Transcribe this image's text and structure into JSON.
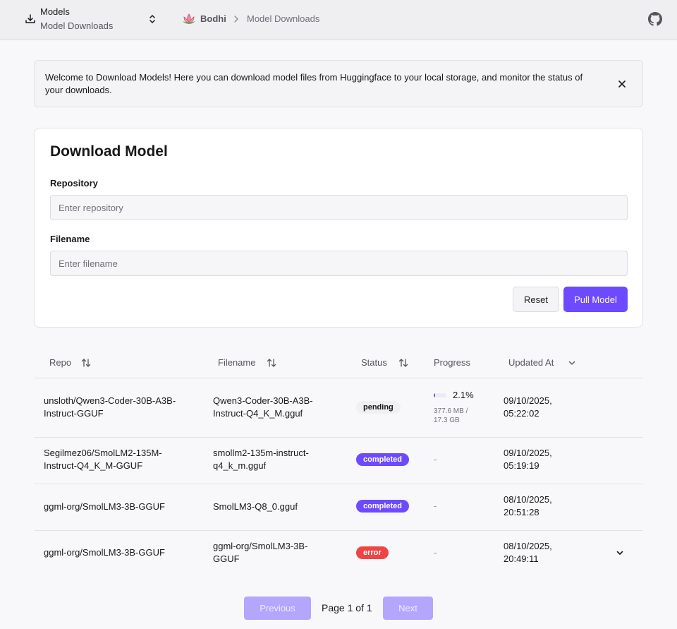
{
  "header": {
    "section_title": "Models",
    "section_subtitle": "Model Downloads",
    "breadcrumb": {
      "home": "Bodhi",
      "current": "Model Downloads"
    }
  },
  "banner": {
    "text": "Welcome to Download Models! Here you can download model files from Huggingface to your local storage, and monitor the status of your downloads."
  },
  "form": {
    "title": "Download Model",
    "repository_label": "Repository",
    "repository_placeholder": "Enter repository",
    "repository_value": "",
    "filename_label": "Filename",
    "filename_placeholder": "Enter filename",
    "filename_value": "",
    "reset_label": "Reset",
    "pull_label": "Pull Model"
  },
  "table": {
    "columns": [
      "Repo",
      "Filename",
      "Status",
      "Progress",
      "Updated At"
    ],
    "rows": [
      {
        "repo_line1": "unsloth/Qwen3-Coder-30B-A3B-",
        "repo_line2": "Instruct-GGUF",
        "file_line1": "Qwen3-Coder-30B-A3B-",
        "file_line2": "Instruct-Q4_K_M.gguf",
        "status": "pending",
        "progress_percent": "2.1%",
        "progress_fraction": 0.021,
        "progress_size_line1": "377.6 MB /",
        "progress_size_line2": "17.3 GB",
        "updated_line1": "09/10/2025,",
        "updated_line2": "05:22:02"
      },
      {
        "repo_line1": "Segilmez06/SmolLM2-135M-",
        "repo_line2": "Instruct-Q4_K_M-GGUF",
        "file_line1": "smollm2-135m-instruct-",
        "file_line2": "q4_k_m.gguf",
        "status": "completed",
        "progress": "-",
        "updated_line1": "09/10/2025,",
        "updated_line2": "05:19:19"
      },
      {
        "repo_line1": "ggml-org/SmolLM3-3B-GGUF",
        "file_line1": "SmolLM3-Q8_0.gguf",
        "status": "completed",
        "progress": "-",
        "updated_line1": "08/10/2025,",
        "updated_line2": "20:51:28"
      },
      {
        "repo_line1": "ggml-org/SmolLM3-3B-GGUF",
        "file_line1": "ggml-org/SmolLM3-3B-",
        "file_line2": "GGUF",
        "status": "error",
        "progress": "-",
        "updated_line1": "08/10/2025,",
        "updated_line2": "20:49:11"
      }
    ]
  },
  "pagination": {
    "previous_label": "Previous",
    "page_info": "Page 1 of 1",
    "next_label": "Next"
  },
  "icons": {
    "download": "download-icon",
    "switcher": "chevrons-up-down-icon",
    "brand": "lotus-icon",
    "separator": "chevron-right-icon",
    "github": "github-icon",
    "close": "close-icon",
    "sort": "sort-arrows-icon",
    "sort_desc": "chevron-down-icon",
    "expand": "chevron-down-icon"
  },
  "colors": {
    "accent": "#6d4aff",
    "error": "#ef4444",
    "disabled_button": "#b3a6fc"
  }
}
